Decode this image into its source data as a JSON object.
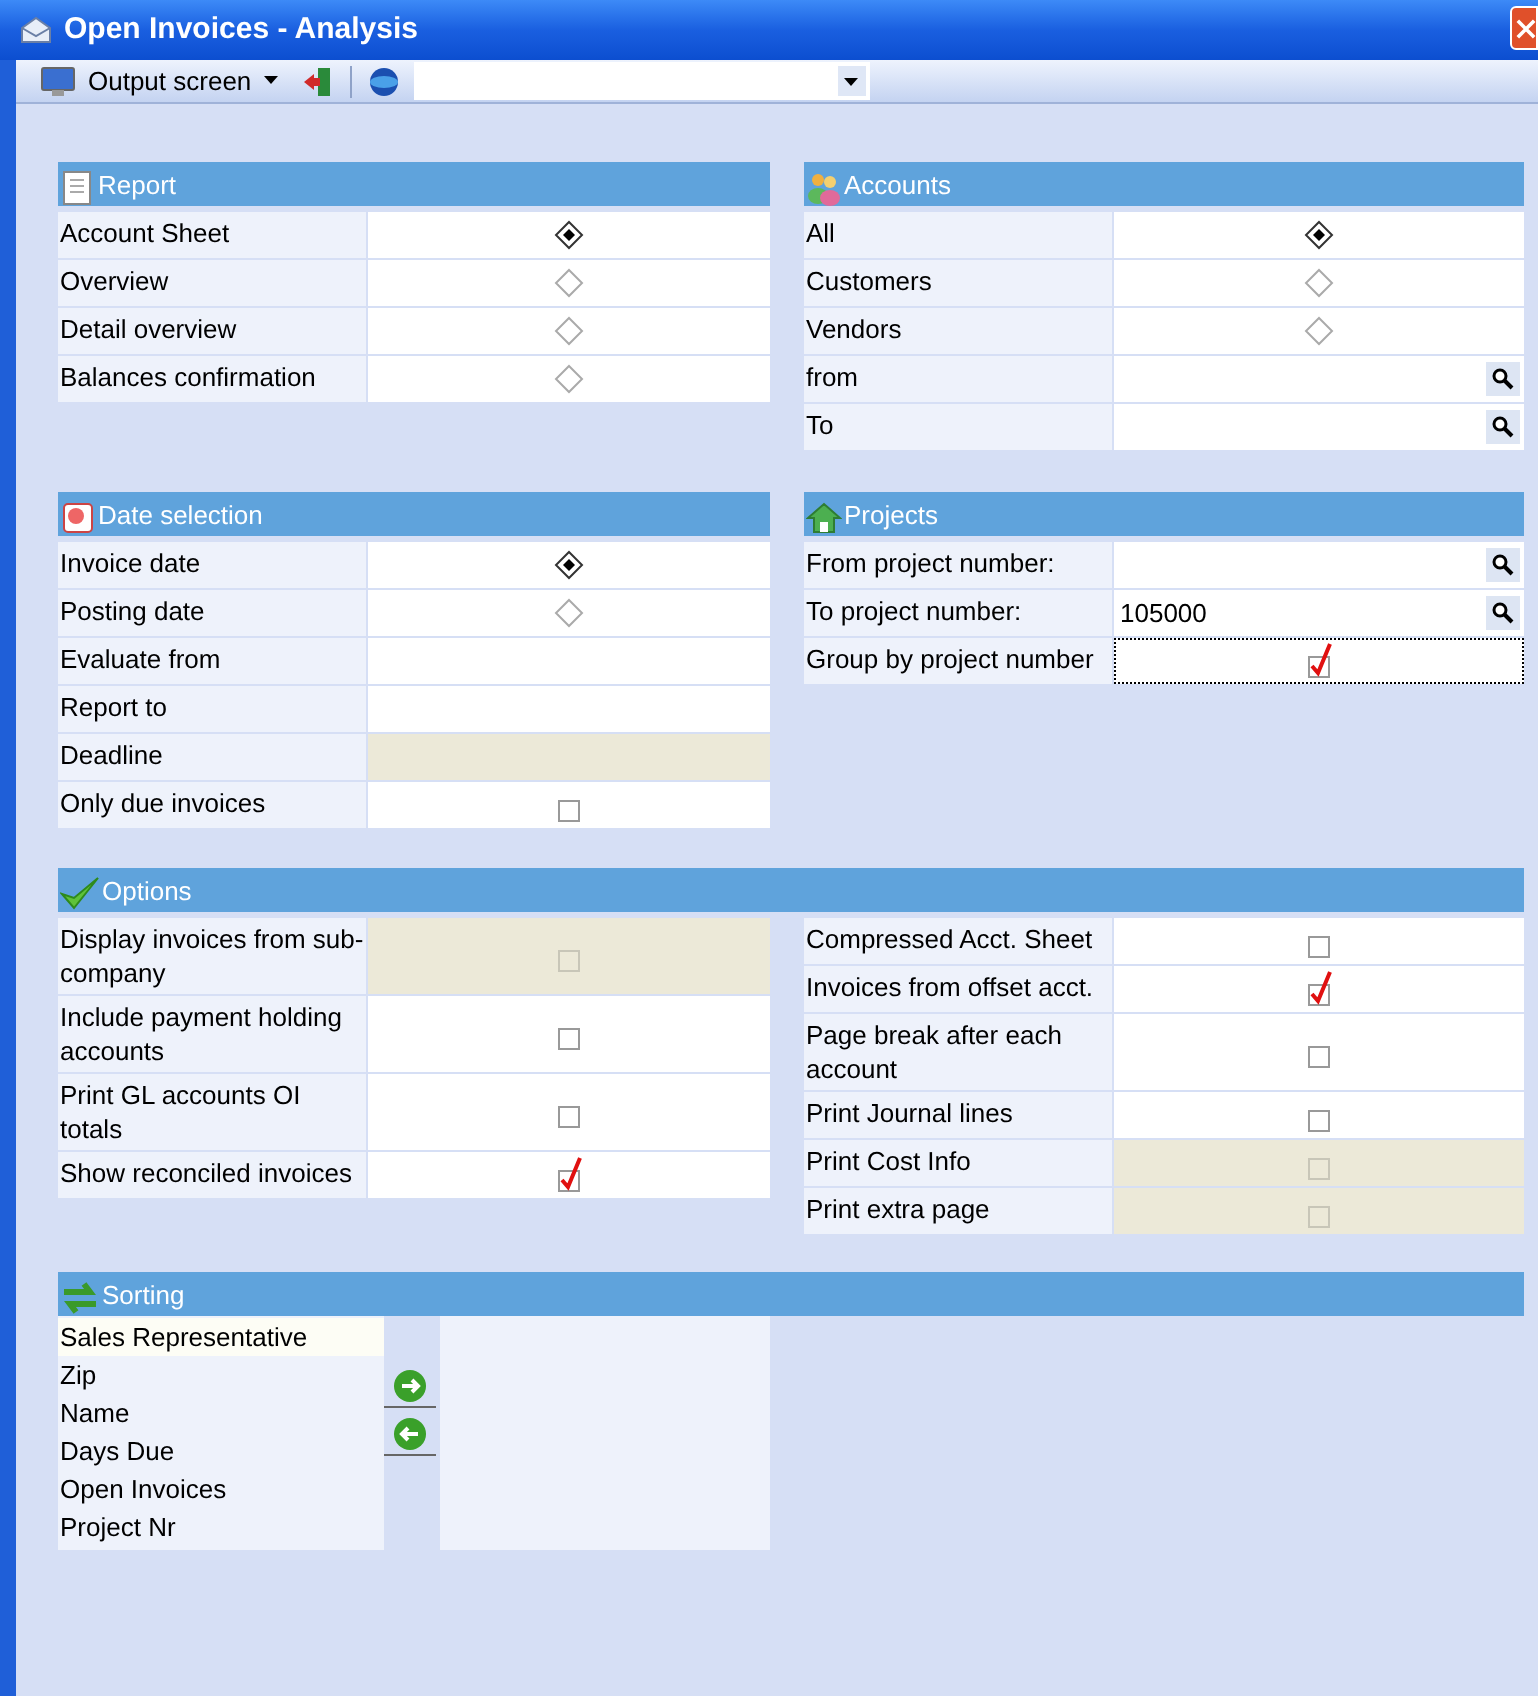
{
  "window": {
    "title": "Open Invoices - Analysis"
  },
  "toolbar": {
    "output_label": "Output screen"
  },
  "report": {
    "title": "Report",
    "rows": [
      {
        "label": "Account Sheet",
        "kind": "radio",
        "selected": true
      },
      {
        "label": "Overview",
        "kind": "radio",
        "selected": false
      },
      {
        "label": "Detail overview",
        "kind": "radio",
        "selected": false
      },
      {
        "label": "Balances confirmation",
        "kind": "radio",
        "selected": false
      }
    ]
  },
  "accounts": {
    "title": "Accounts",
    "rows": [
      {
        "label": "All",
        "kind": "radio",
        "selected": true
      },
      {
        "label": "Customers",
        "kind": "radio",
        "selected": false
      },
      {
        "label": "Vendors",
        "kind": "radio",
        "selected": false
      },
      {
        "label": "from",
        "kind": "lookup"
      },
      {
        "label": "To",
        "kind": "lookup"
      }
    ]
  },
  "date_selection": {
    "title": "Date selection",
    "rows": [
      {
        "label": "Invoice date",
        "kind": "radio",
        "selected": true
      },
      {
        "label": "Posting date",
        "kind": "radio",
        "selected": false
      },
      {
        "label": "Evaluate from",
        "kind": "field",
        "disabled": false
      },
      {
        "label": "Report to",
        "kind": "field",
        "disabled": false
      },
      {
        "label": "Deadline",
        "kind": "field",
        "disabled": true
      },
      {
        "label": "Only due invoices",
        "kind": "checkbox",
        "checked": false,
        "disabled": false
      }
    ]
  },
  "projects": {
    "title": "Projects",
    "rows": [
      {
        "label": "From project number:",
        "kind": "lookup"
      },
      {
        "label": "To project number:",
        "kind": "lookup",
        "value": "105000"
      },
      {
        "label": "Group by project number",
        "kind": "checkbox",
        "checked": true,
        "disabled": false
      }
    ]
  },
  "options": {
    "title": "Options",
    "left": [
      {
        "label": "Display invoices from sub-company",
        "kind": "checkbox",
        "checked": false,
        "disabled": true
      },
      {
        "label": "Include payment holding accounts",
        "kind": "checkbox",
        "checked": false,
        "disabled": false
      },
      {
        "label": "Print GL accounts OI totals",
        "kind": "checkbox",
        "checked": false,
        "disabled": false
      },
      {
        "label": "Show reconciled invoices",
        "kind": "checkbox",
        "checked": true,
        "disabled": false
      }
    ],
    "right": [
      {
        "label": "Compressed Acct. Sheet",
        "kind": "checkbox",
        "checked": false,
        "disabled": false
      },
      {
        "label": "Invoices from offset acct.",
        "kind": "checkbox",
        "checked": true,
        "disabled": false
      },
      {
        "label": "Page break after each account",
        "kind": "checkbox",
        "checked": false,
        "disabled": false
      },
      {
        "label": "Print Journal lines",
        "kind": "checkbox",
        "checked": false,
        "disabled": false
      },
      {
        "label": "Print Cost Info",
        "kind": "checkbox",
        "checked": false,
        "disabled": true
      },
      {
        "label": "Print extra page",
        "kind": "checkbox",
        "checked": false,
        "disabled": true
      }
    ]
  },
  "sorting": {
    "title": "Sorting",
    "available": [
      {
        "label": "Sales Representative",
        "selected": true
      },
      {
        "label": "Zip",
        "selected": false
      },
      {
        "label": "Name",
        "selected": false
      },
      {
        "label": "Days Due",
        "selected": false
      },
      {
        "label": "Open Invoices",
        "selected": false
      },
      {
        "label": "Project Nr",
        "selected": false
      }
    ]
  }
}
